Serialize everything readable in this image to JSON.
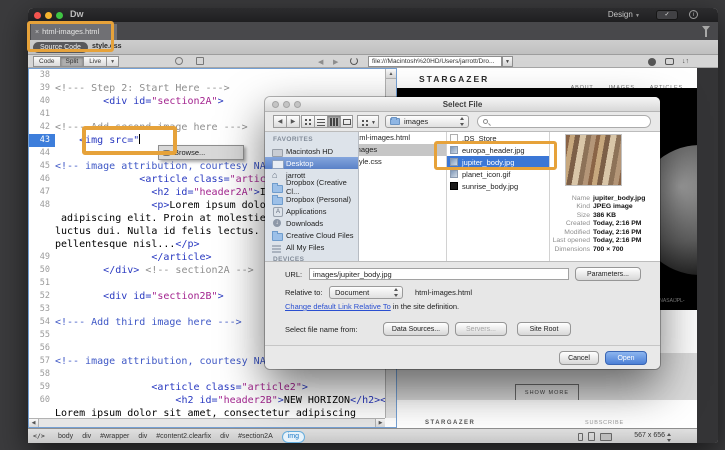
{
  "window": {
    "app_name": "Dw",
    "workspace": "Design",
    "tab": {
      "close": "×",
      "label": "html-images.html"
    },
    "related": {
      "source": "Source Code",
      "css": "style.css"
    },
    "modes": [
      "Code",
      "Split",
      "Live"
    ],
    "url": "file:///Macintosh%20HD/Users/jarrott/Dro..."
  },
  "editor": {
    "active_line": "43",
    "browse_hint": "Browse...",
    "lines": [
      {
        "n": "38",
        "tokens": []
      },
      {
        "n": "39",
        "tokens": [
          [
            "c",
            "<!--- Step 2: Start Here --->"
          ]
        ]
      },
      {
        "n": "40",
        "tokens": [
          [
            "t",
            "        "
          ],
          [
            "b",
            "<div id="
          ],
          [
            "m",
            "\"section2A\""
          ],
          [
            "b",
            ">"
          ]
        ]
      },
      {
        "n": "41",
        "tokens": []
      },
      {
        "n": "42",
        "tokens": [
          [
            "c",
            "<!--- Add second image here --->"
          ]
        ]
      },
      {
        "n": "43",
        "active": true,
        "cursor": true,
        "tokens": [
          [
            "t",
            "    "
          ],
          [
            "b",
            "<img src=\""
          ]
        ]
      },
      {
        "n": "44",
        "tokens": []
      },
      {
        "n": "45",
        "tokens": [
          [
            "k",
            "<!-- image attribution, courtesy NAS"
          ]
        ]
      },
      {
        "n": "46",
        "tokens": [
          [
            "t",
            "              "
          ],
          [
            "b",
            "<article class="
          ],
          [
            "m",
            "\"article2\""
          ]
        ]
      },
      {
        "n": "47",
        "tokens": [
          [
            "t",
            "                "
          ],
          [
            "b",
            "<h2 id="
          ],
          [
            "m",
            "\"header2A\""
          ],
          [
            "b",
            ">"
          ],
          [
            "t",
            "INSIDE"
          ]
        ]
      },
      {
        "n": "48",
        "tokens": [
          [
            "t",
            "                "
          ],
          [
            "b",
            "<p>"
          ],
          [
            "t",
            "Lorem ipsum dolor sit"
          ]
        ]
      },
      {
        "n": "",
        "wrap": true,
        "tokens": [
          [
            "t",
            " adipiscing elit. Proin at molestie"
          ]
        ]
      },
      {
        "n": "",
        "wrap": true,
        "tokens": [
          [
            "t",
            "luctus dui. Nulla id felis lectus. N"
          ]
        ]
      },
      {
        "n": "",
        "wrap": true,
        "tokens": [
          [
            "t",
            "pellentesque nisl..."
          ],
          [
            "b",
            "</p>"
          ]
        ]
      },
      {
        "n": "49",
        "tokens": [
          [
            "t",
            "                "
          ],
          [
            "b",
            "</article>"
          ]
        ]
      },
      {
        "n": "50",
        "tokens": [
          [
            "t",
            "        "
          ],
          [
            "b",
            "</div>"
          ],
          [
            "t",
            " "
          ],
          [
            "c",
            "<!-- section2A -->"
          ]
        ]
      },
      {
        "n": "51",
        "tokens": []
      },
      {
        "n": "52",
        "tokens": [
          [
            "t",
            "        "
          ],
          [
            "b",
            "<div id="
          ],
          [
            "m",
            "\"section2B\""
          ],
          [
            "b",
            ">"
          ]
        ]
      },
      {
        "n": "53",
        "tokens": []
      },
      {
        "n": "54",
        "tokens": [
          [
            "k",
            "<!--- Add third image here --->"
          ]
        ]
      },
      {
        "n": "55",
        "tokens": []
      },
      {
        "n": "56",
        "tokens": []
      },
      {
        "n": "57",
        "tokens": [
          [
            "k",
            "<!-- image attribution, courtesy NAS"
          ]
        ]
      },
      {
        "n": "58",
        "tokens": []
      },
      {
        "n": "59",
        "tokens": [
          [
            "t",
            "                "
          ],
          [
            "b",
            "<article class="
          ],
          [
            "m",
            "\"article2\""
          ],
          [
            "b",
            ">"
          ]
        ]
      },
      {
        "n": "60",
        "tokens": [
          [
            "t",
            "                    "
          ],
          [
            "b",
            "<h2 id="
          ],
          [
            "m",
            "\"header2B\""
          ],
          [
            "b",
            ">"
          ],
          [
            "t",
            "NEW HORIZON"
          ],
          [
            "b",
            "</h2><p>"
          ]
        ]
      },
      {
        "n": "",
        "wrap": true,
        "tokens": [
          [
            "t",
            "Lorem ipsum dolor sit amet, consectetur adipiscing"
          ]
        ]
      }
    ]
  },
  "preview": {
    "site_title": "STARGAZER",
    "nav": [
      "ABOUT",
      "IMAGES",
      "ARTICLES"
    ],
    "hero_caption": "courtesy NASA/JPL-Caltech",
    "show_more": "SHOW MORE",
    "footer_brand": "STARGAZER",
    "footer_sub": "SUBSCRIBE"
  },
  "dialog": {
    "title": "Select File",
    "location": "images",
    "sidebar": {
      "favorites_header": "FAVORITES",
      "devices_header": "DEVICES",
      "items": [
        {
          "label": "Macintosh HD",
          "icon": "drive"
        },
        {
          "label": "Desktop",
          "icon": "desktop",
          "selected": true
        },
        {
          "label": "jarrott",
          "icon": "home"
        },
        {
          "label": "Dropbox (Creative Cl...",
          "icon": "folder"
        },
        {
          "label": "Dropbox (Personal)",
          "icon": "folder"
        },
        {
          "label": "Applications",
          "icon": "apps"
        },
        {
          "label": "Downloads",
          "icon": "downloads"
        },
        {
          "label": "Creative Cloud Files",
          "icon": "folder"
        },
        {
          "label": "All My Files",
          "icon": "files"
        }
      ]
    },
    "col1": [
      {
        "label": "html-images.html"
      },
      {
        "label": "images",
        "selected": true
      },
      {
        "label": "style.css"
      }
    ],
    "col2": [
      {
        "label": ".DS_Store",
        "icon": "doc"
      },
      {
        "label": "europa_header.jpg",
        "icon": "image"
      },
      {
        "label": "jupiter_body.jpg",
        "icon": "image",
        "selected": true
      },
      {
        "label": "planet_icon.gif",
        "icon": "image"
      },
      {
        "label": "sunrise_body.jpg",
        "icon": "image-dark"
      }
    ],
    "info_rows": [
      [
        "Name",
        "jupiter_body.jpg"
      ],
      [
        "Kind",
        "JPEG image"
      ],
      [
        "Size",
        "386 KB"
      ],
      [
        "Created",
        "Today, 2:16 PM"
      ],
      [
        "Modified",
        "Today, 2:16 PM"
      ],
      [
        "Last opened",
        "Today, 2:16 PM"
      ],
      [
        "Dimensions",
        "700 × 700"
      ]
    ],
    "url_label": "URL:",
    "url_value": "images/jupiter_body.jpg",
    "parameters_btn": "Parameters...",
    "relative_label": "Relative to:",
    "relative_value": "Document",
    "relative_doc": "html-images.html",
    "link_text": "Change default Link Relative To",
    "link_suffix": " in the site definition.",
    "select_from_label": "Select file name from:",
    "data_sources_btn": "Data Sources...",
    "servers_btn": "Servers...",
    "site_root_btn": "Site Root",
    "cancel_btn": "Cancel",
    "open_btn": "Open"
  },
  "statusbar": {
    "code_icon": "</>",
    "tags": [
      {
        "label": "body"
      },
      {
        "label": "div"
      },
      {
        "label": "#wrapper"
      },
      {
        "label": "div"
      },
      {
        "label": "#content2.clearfix"
      },
      {
        "label": "div"
      },
      {
        "label": "#section2A"
      },
      {
        "label": "img",
        "current": true
      }
    ],
    "dims": "567 x 656"
  },
  "colors": {
    "callout_orange": "#E6A23A",
    "active_line_blue": "#3D7EDB",
    "mac_selection_blue": "#3B77D6"
  }
}
